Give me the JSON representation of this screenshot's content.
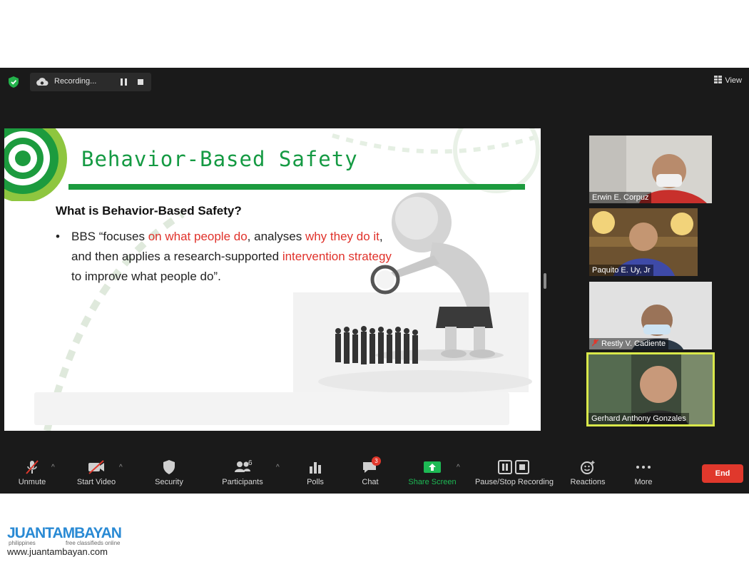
{
  "top_bar": {
    "recording_label": "Recording...",
    "view_label": "View"
  },
  "slide": {
    "title": "Behavior-Based Safety",
    "question": "What is Behavior-Based Safety?",
    "bullet_mark": "•",
    "bullet": {
      "p1": "BBS “focuses ",
      "p2": "on what people do",
      "p3": ", analyses ",
      "p4": "why they do it",
      "p5": ", and then applies a research-supported ",
      "p6": "intervention strategy",
      "p7": " to improve what people do”."
    }
  },
  "participants_panel": [
    {
      "name": "Erwin E. Corpuz"
    },
    {
      "name": "Paquito E. Uy, Jr"
    },
    {
      "name": "Restly V. Cadiente"
    },
    {
      "name": "Gerhard Anthony Gonzales"
    }
  ],
  "toolbar": {
    "unmute": "Unmute",
    "start_video": "Start Video",
    "security": "Security",
    "participants": "Participants",
    "participants_count": "6",
    "polls": "Polls",
    "chat": "Chat",
    "chat_badge": "3",
    "share_screen": "Share Screen",
    "pause_stop_recording": "Pause/Stop Recording",
    "reactions": "Reactions",
    "more": "More",
    "end": "End"
  },
  "watermark": {
    "brand": "JUANTAMBAYAN",
    "tagline_left": "philippines",
    "tagline_right": "free classifieds online",
    "url": "www.juantambayan.com"
  },
  "colors": {
    "title_green": "#159a43",
    "highlight_red": "#e0322b",
    "end_red": "#e0382c",
    "share_green": "#1db954",
    "toolbar_bg": "#1a1a1a"
  }
}
